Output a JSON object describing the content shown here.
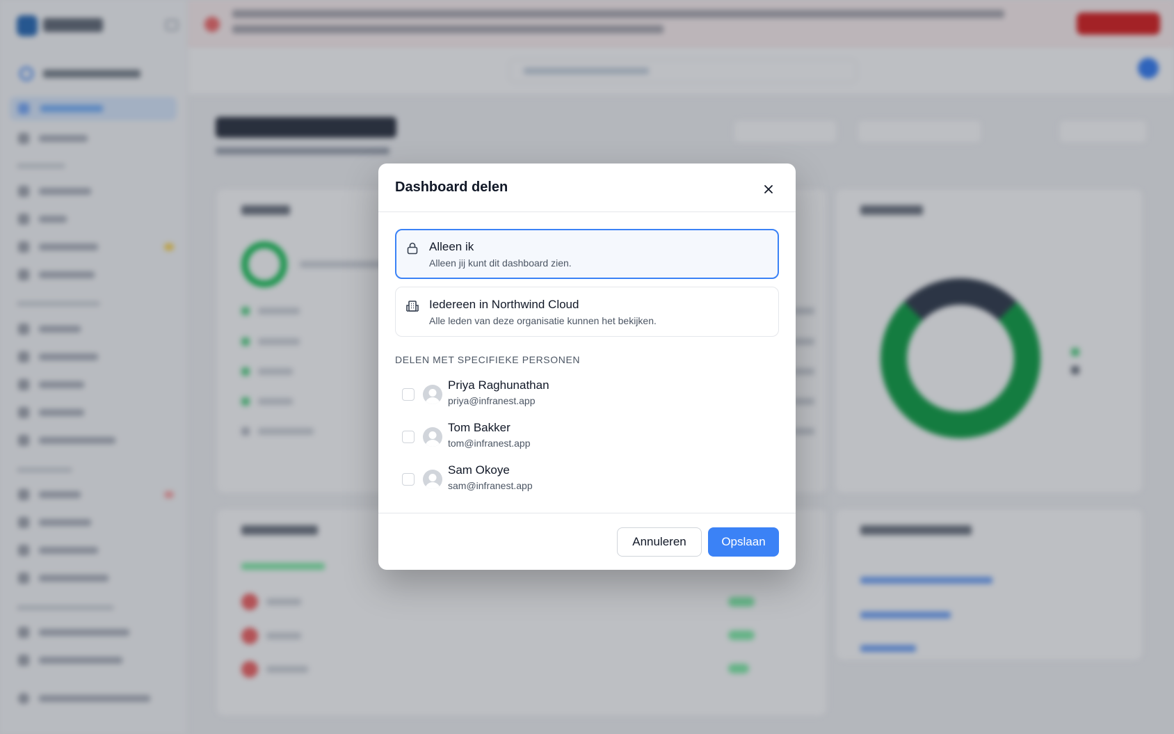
{
  "modal": {
    "title": "Dashboard delen",
    "close_icon": "close-icon",
    "options": [
      {
        "icon": "lock-icon",
        "title": "Alleen ik",
        "description": "Alleen jij kunt dit dashboard zien.",
        "selected": true
      },
      {
        "icon": "building-icon",
        "title": "Iedereen in Northwind Cloud",
        "description": "Alle leden van deze organisatie kunnen het bekijken.",
        "selected": false
      }
    ],
    "section_label": "DELEN MET SPECIFIEKE PERSONEN",
    "people": [
      {
        "name": "Priya Raghunathan",
        "email": "priya@infranest.app",
        "checked": false
      },
      {
        "name": "Tom Bakker",
        "email": "tom@infranest.app",
        "checked": false
      },
      {
        "name": "Sam Okoye",
        "email": "sam@infranest.app",
        "checked": false
      }
    ],
    "cancel_label": "Annuleren",
    "save_label": "Opslaan"
  },
  "colors": {
    "accent": "#3b82f6",
    "selected_bg": "#f5f8fd",
    "banner_alert": "#dc2626",
    "chart_green": "#16a34a"
  }
}
